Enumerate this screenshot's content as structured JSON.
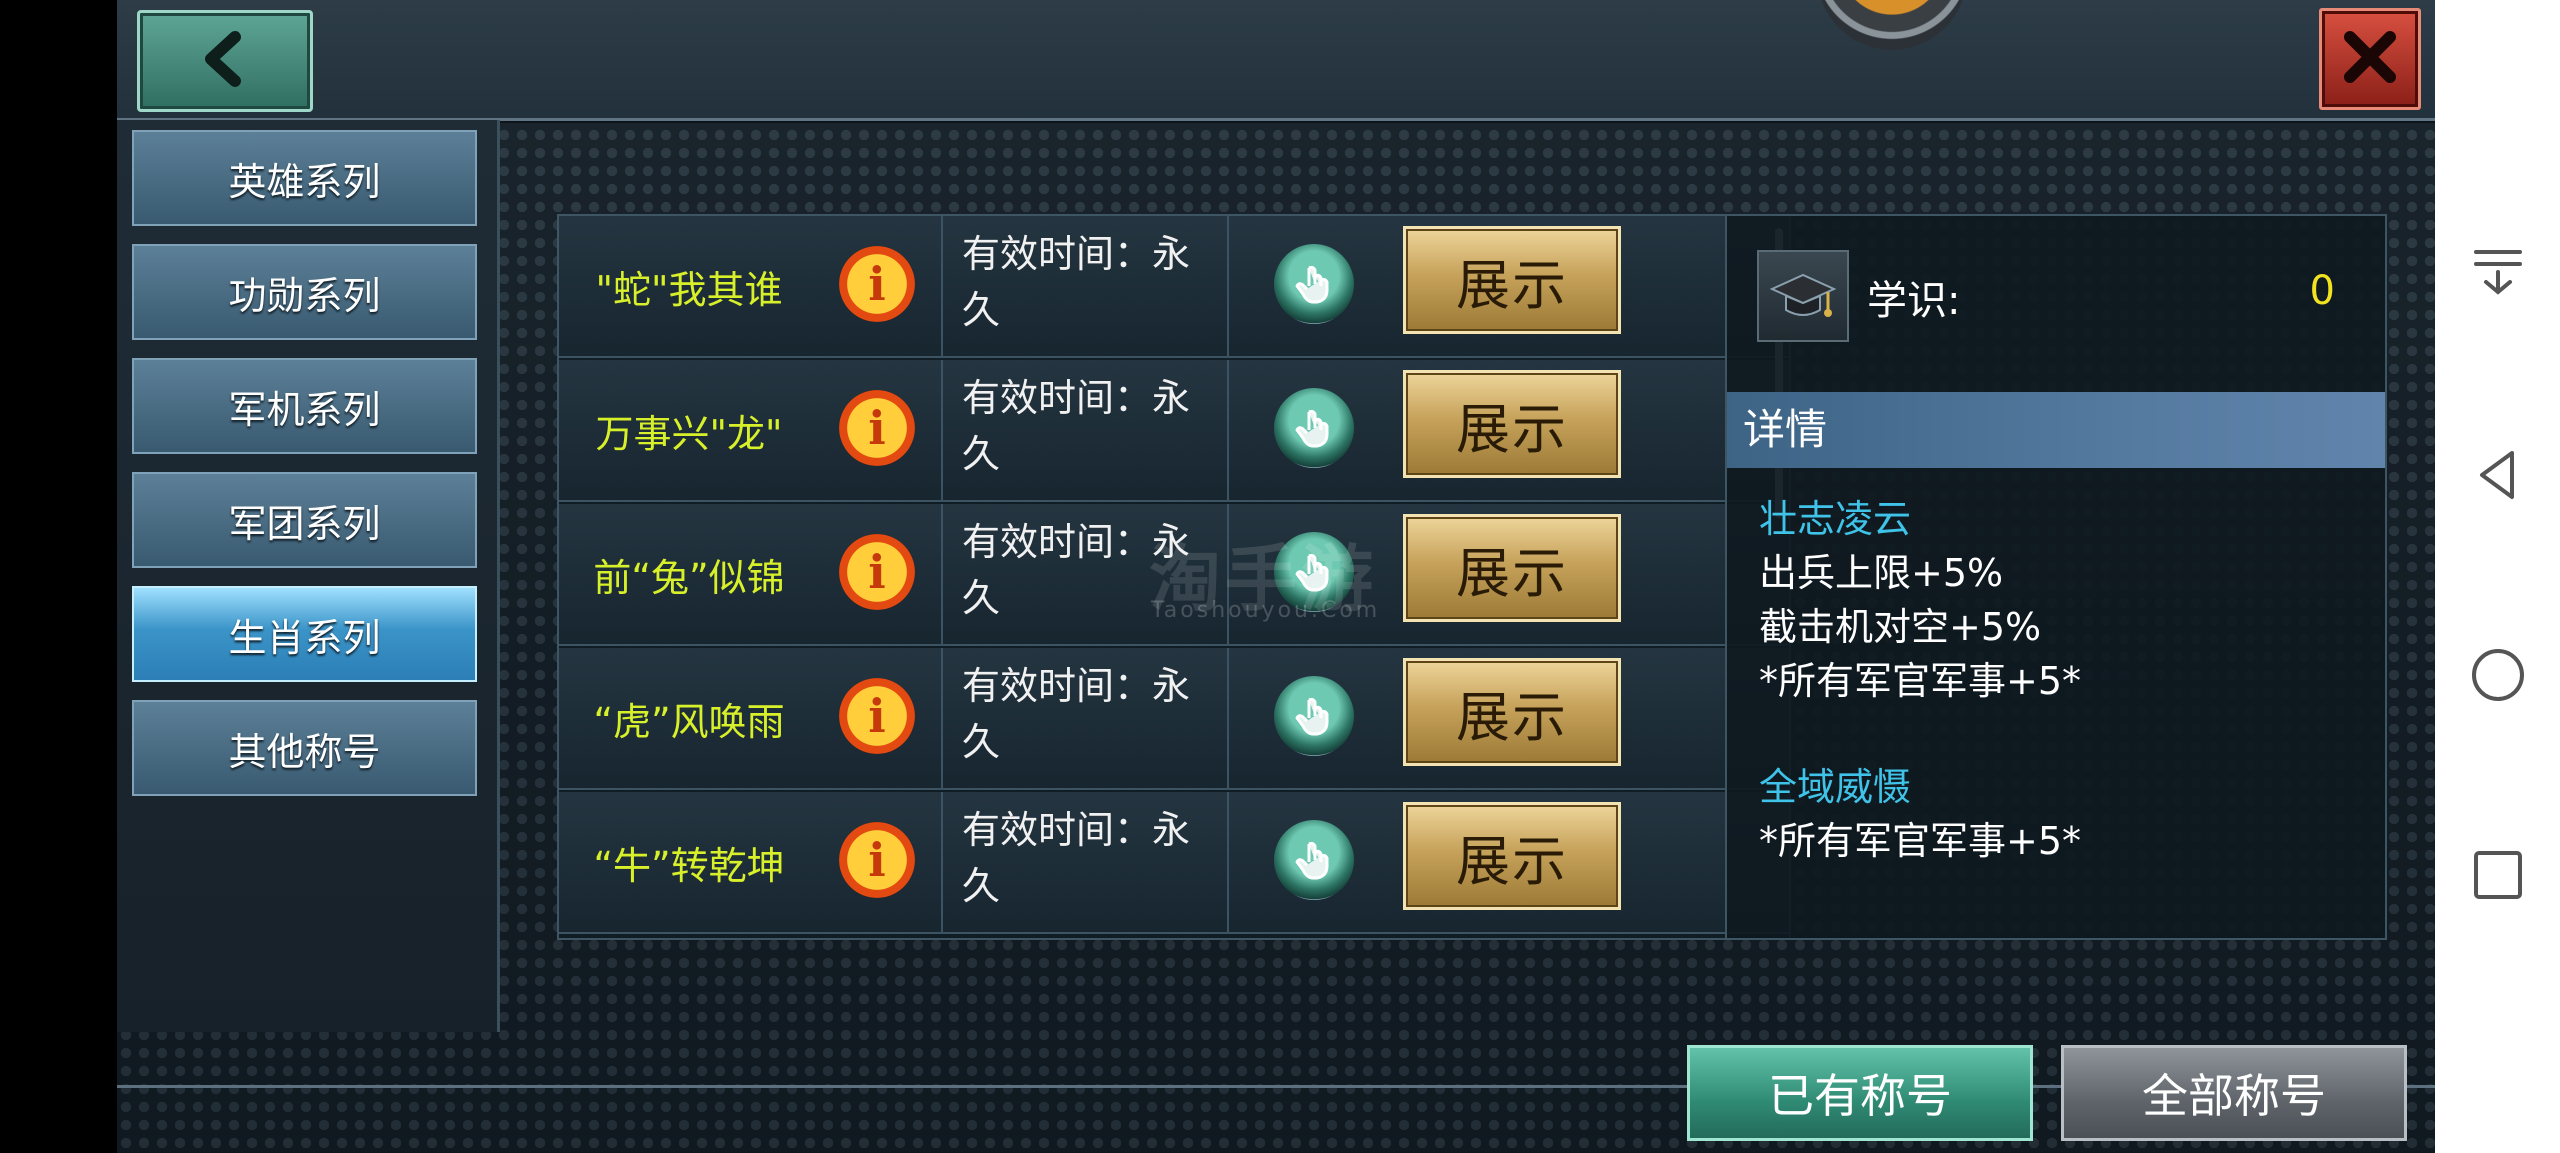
{
  "sidebar": {
    "items": [
      {
        "label": "英雄系列",
        "active": false
      },
      {
        "label": "功勋系列",
        "active": false
      },
      {
        "label": "军机系列",
        "active": false
      },
      {
        "label": "军团系列",
        "active": false
      },
      {
        "label": "生肖系列",
        "active": true
      },
      {
        "label": "其他称号",
        "active": false
      }
    ]
  },
  "list": {
    "rows": [
      {
        "title": "\"蛇\"我其谁",
        "validity_line1": "有效时间：永",
        "validity_line2": "久",
        "button": "展示"
      },
      {
        "title": "万事兴\"龙\"",
        "validity_line1": "有效时间：永",
        "validity_line2": "久",
        "button": "展示"
      },
      {
        "title": "前“兔”似锦",
        "validity_line1": "有效时间：永",
        "validity_line2": "久",
        "button": "展示"
      },
      {
        "title": "“虎”风唤雨",
        "validity_line1": "有效时间：永",
        "validity_line2": "久",
        "button": "展示"
      },
      {
        "title": "“牛”转乾坤",
        "validity_line1": "有效时间：永",
        "validity_line2": "久",
        "button": "展示"
      }
    ],
    "info_glyph": "i"
  },
  "detail": {
    "knowledge_label": "学识:",
    "knowledge_value": "0",
    "header": "详情",
    "sections": [
      {
        "title": "壮志凌云",
        "lines": [
          "出兵上限+5%",
          "截击机对空+5%",
          "*所有军官军事+5*"
        ]
      },
      {
        "title": "全域威慑",
        "lines": [
          "*所有军官军事+5*"
        ]
      }
    ]
  },
  "tabs": {
    "owned": "已有称号",
    "all": "全部称号"
  },
  "watermark": {
    "main": "淘手游",
    "sub": "Taoshouyou.Com"
  },
  "icons": {
    "back": "chevron-left-icon",
    "close": "close-icon",
    "info": "info-icon",
    "hand": "hand-pointer-icon",
    "scholar": "graduation-cap-icon"
  },
  "colors": {
    "title_yellow": "#d8f02a",
    "detail_title_cyan": "#3fc3e8",
    "knowledge_value_yellow": "#f2e320",
    "close_red": "#b8382c",
    "back_teal": "#3f8a7a"
  }
}
